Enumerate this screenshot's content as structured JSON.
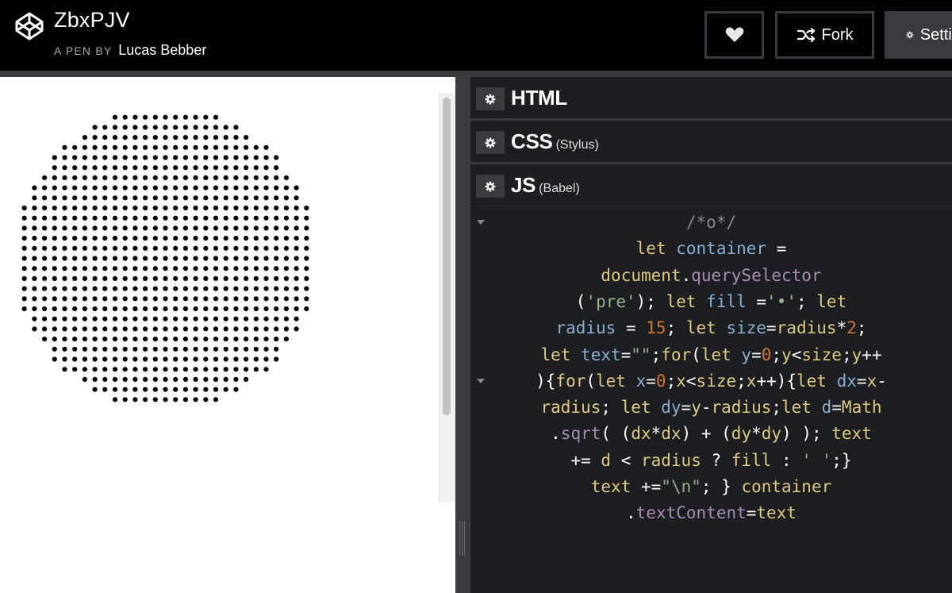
{
  "header": {
    "pen_title": "ZbxPJV",
    "pen_by_label": "A PEN BY",
    "author": "Lucas Bebber",
    "logo_icon": "codepen-logo",
    "heart_icon": "heart-icon",
    "fork_icon": "fork-icon",
    "fork_label": "Fork",
    "settings_icon": "gear-icon",
    "settings_label": "Settings"
  },
  "preview": {
    "fill_char": "•",
    "radius": 15,
    "dot_color": "#000000",
    "background": "#ffffff"
  },
  "editors": {
    "html": {
      "title": "HTML",
      "subtitle": ""
    },
    "css": {
      "title": "CSS",
      "subtitle": "(Stylus)"
    },
    "js": {
      "title": "JS",
      "subtitle": "(Babel)"
    }
  },
  "code_lines": [
    {
      "fold": true,
      "tokens": [
        [
          "com",
          "/*o*/"
        ]
      ]
    },
    {
      "fold": false,
      "tokens": [
        [
          "kw",
          "let"
        ],
        [
          "pl",
          " "
        ],
        [
          "var",
          "container"
        ],
        [
          "pl",
          " ="
        ]
      ]
    },
    {
      "fold": false,
      "tokens": [
        [
          "kw",
          "document"
        ],
        [
          "pl",
          "."
        ],
        [
          "fn",
          "querySelector"
        ]
      ]
    },
    {
      "fold": false,
      "tokens": [
        [
          "pl",
          "("
        ],
        [
          "str",
          "'pre'"
        ],
        [
          "pl",
          "); "
        ],
        [
          "kw",
          "let"
        ],
        [
          "pl",
          " "
        ],
        [
          "var",
          "fill"
        ],
        [
          "pl",
          " ="
        ],
        [
          "str",
          "'•'"
        ],
        [
          "pl",
          "; "
        ],
        [
          "kw",
          "let"
        ]
      ]
    },
    {
      "fold": false,
      "tokens": [
        [
          "var",
          "radius"
        ],
        [
          "pl",
          " = "
        ],
        [
          "num",
          "15"
        ],
        [
          "pl",
          "; "
        ],
        [
          "kw",
          "let"
        ],
        [
          "pl",
          " "
        ],
        [
          "var",
          "size"
        ],
        [
          "pl",
          "="
        ],
        [
          "kw",
          "radius"
        ],
        [
          "pl",
          "*"
        ],
        [
          "num",
          "2"
        ],
        [
          "pl",
          ";"
        ]
      ]
    },
    {
      "fold": false,
      "tokens": [
        [
          "kw",
          "let"
        ],
        [
          "pl",
          " "
        ],
        [
          "var",
          "text"
        ],
        [
          "pl",
          "="
        ],
        [
          "str",
          "\"\""
        ],
        [
          "pl",
          ";"
        ],
        [
          "kw",
          "for"
        ],
        [
          "pl",
          "("
        ],
        [
          "kw",
          "let"
        ],
        [
          "pl",
          " "
        ],
        [
          "var",
          "y"
        ],
        [
          "pl",
          "="
        ],
        [
          "num",
          "0"
        ],
        [
          "pl",
          ";"
        ],
        [
          "kw",
          "y"
        ],
        [
          "pl",
          "<"
        ],
        [
          "kw",
          "size"
        ],
        [
          "pl",
          ";"
        ],
        [
          "kw",
          "y"
        ],
        [
          "pl",
          "++"
        ]
      ]
    },
    {
      "fold": true,
      "tokens": [
        [
          "pl",
          "){"
        ],
        [
          "kw",
          "for"
        ],
        [
          "pl",
          "("
        ],
        [
          "kw",
          "let"
        ],
        [
          "pl",
          " "
        ],
        [
          "var",
          "x"
        ],
        [
          "pl",
          "="
        ],
        [
          "num",
          "0"
        ],
        [
          "pl",
          ";"
        ],
        [
          "kw",
          "x"
        ],
        [
          "pl",
          "<"
        ],
        [
          "kw",
          "size"
        ],
        [
          "pl",
          ";"
        ],
        [
          "kw",
          "x"
        ],
        [
          "pl",
          "++){"
        ],
        [
          "kw",
          "let"
        ],
        [
          "pl",
          " "
        ],
        [
          "var",
          "dx"
        ],
        [
          "pl",
          "="
        ],
        [
          "kw",
          "x"
        ],
        [
          "pl",
          "-"
        ]
      ]
    },
    {
      "fold": false,
      "tokens": [
        [
          "kw",
          "radius"
        ],
        [
          "pl",
          "; "
        ],
        [
          "kw",
          "let"
        ],
        [
          "pl",
          " "
        ],
        [
          "var",
          "dy"
        ],
        [
          "pl",
          "="
        ],
        [
          "kw",
          "y"
        ],
        [
          "pl",
          "-"
        ],
        [
          "kw",
          "radius"
        ],
        [
          "pl",
          ";"
        ],
        [
          "kw",
          "let"
        ],
        [
          "pl",
          " "
        ],
        [
          "var",
          "d"
        ],
        [
          "pl",
          "="
        ],
        [
          "kw",
          "Math"
        ]
      ]
    },
    {
      "fold": false,
      "tokens": [
        [
          "pl",
          "."
        ],
        [
          "fn",
          "sqrt"
        ],
        [
          "pl",
          "( ("
        ],
        [
          "kw",
          "dx"
        ],
        [
          "pl",
          "*"
        ],
        [
          "kw",
          "dx"
        ],
        [
          "pl",
          ") + ("
        ],
        [
          "kw",
          "dy"
        ],
        [
          "pl",
          "*"
        ],
        [
          "kw",
          "dy"
        ],
        [
          "pl",
          ") ); "
        ],
        [
          "kw",
          "text"
        ]
      ]
    },
    {
      "fold": false,
      "tokens": [
        [
          "pl",
          "+= "
        ],
        [
          "kw",
          "d"
        ],
        [
          "pl",
          " < "
        ],
        [
          "kw",
          "radius"
        ],
        [
          "pl",
          " ? "
        ],
        [
          "kw",
          "fill"
        ],
        [
          "pl",
          " : "
        ],
        [
          "str",
          "' '"
        ],
        [
          "pl",
          ";}"
        ]
      ]
    },
    {
      "fold": false,
      "tokens": [
        [
          "kw",
          "text"
        ],
        [
          "pl",
          " +="
        ],
        [
          "str",
          "\"\\n\""
        ],
        [
          "pl",
          "; } "
        ],
        [
          "kw",
          "container"
        ]
      ]
    },
    {
      "fold": false,
      "tokens": [
        [
          "pl",
          "."
        ],
        [
          "fn",
          "textContent"
        ],
        [
          "pl",
          "="
        ],
        [
          "kw",
          "text"
        ]
      ]
    }
  ]
}
